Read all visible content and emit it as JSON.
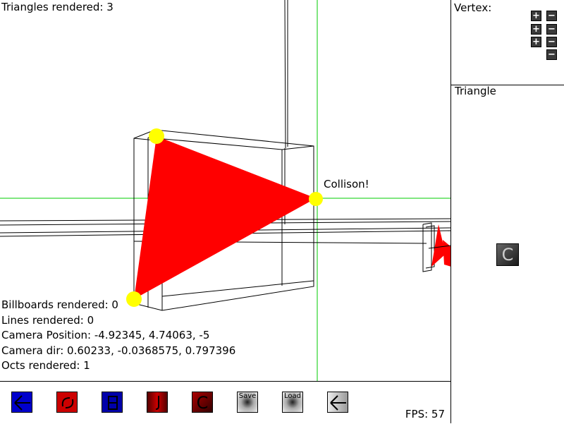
{
  "hud": {
    "triangles_rendered": "Triangles rendered: 3",
    "collision_label": "Collison!",
    "billboards_rendered": "Billboards rendered: 0",
    "lines_rendered": "Lines rendered: 0",
    "camera_position": "Camera Position: -4.92345, 4.74063, -5",
    "camera_dir": "Camera dir: 0.60233, -0.0368575, 0.797396",
    "octs_rendered": "Octs rendered: 1"
  },
  "right_panel": {
    "vertex_label": "Vertex:",
    "triangle_label": "Triangle",
    "plus_glyph": "+",
    "minus_glyph": "−",
    "c_button_label": "C"
  },
  "toolbar": {
    "save_label": "Save",
    "load_label": "Load",
    "c_label": "C",
    "fps": "FPS: 57"
  },
  "colors": {
    "triangle_fill": "#ff0000",
    "vertex_marker": "#ffff00",
    "axis_lines": "#00cc00",
    "wireframe": "#000000"
  }
}
